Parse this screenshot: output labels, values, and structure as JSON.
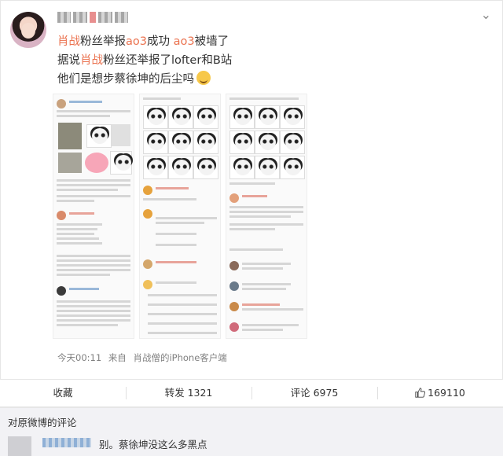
{
  "post": {
    "content": {
      "line1": {
        "tag1": "肖战",
        "mid1": "粉丝举报",
        "tag2": "ao3",
        "mid2": "成功 ",
        "tag3": "ao3",
        "end": "被墙了"
      },
      "line2": {
        "pre": "据说",
        "tag": "肖战",
        "post": "粉丝还举报了lofter和B站"
      },
      "line3": {
        "text": "他们是想步蔡徐坤的后尘吗"
      }
    },
    "meta": {
      "time": "今天00:11",
      "from_label": "来自",
      "source": "肖战僧的iPhone客户端"
    },
    "actions": {
      "favorite": "收藏",
      "repost": "转发 1321",
      "comment": "评论 6975",
      "like": "169110"
    },
    "icons": {
      "more": "chevron-down-icon",
      "like": "thumbs-up-icon",
      "emoji": "smirk-emoji-icon"
    }
  },
  "comments": {
    "header": "对原微博的评论",
    "first": {
      "text": "别。蔡徐坤没这么多黑点"
    }
  },
  "colors": {
    "highlight": "#eb7350",
    "comment_bg": "#f2f2f5"
  }
}
